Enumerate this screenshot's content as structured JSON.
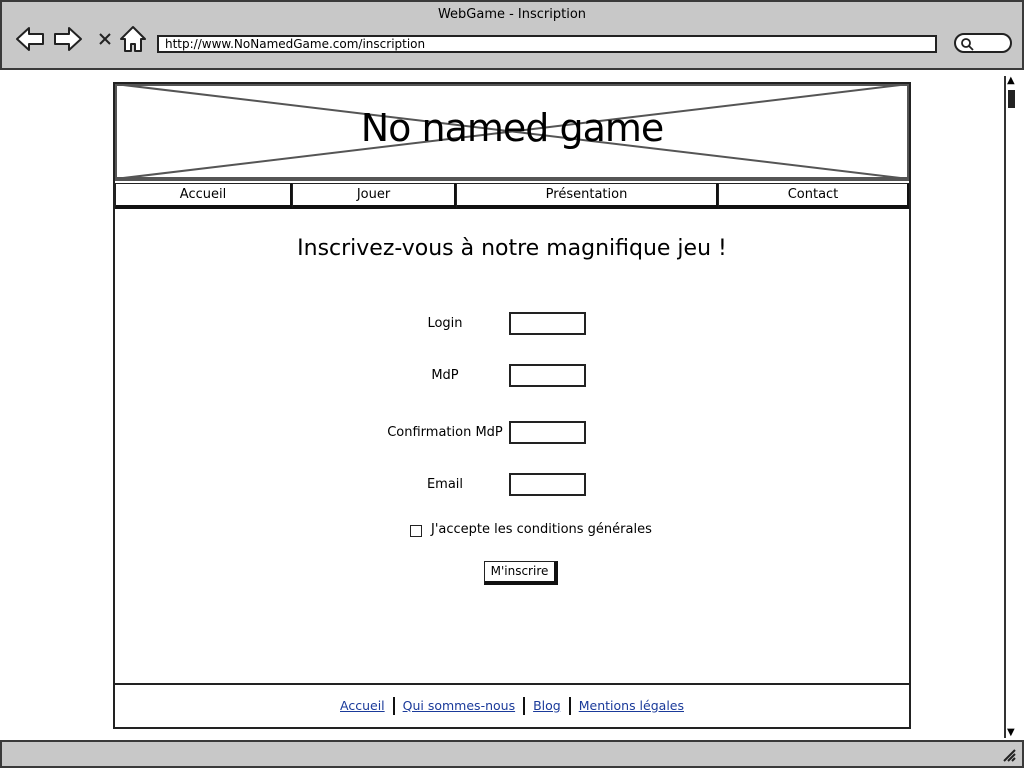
{
  "window": {
    "title": "WebGame - Inscription",
    "url": "http://www.NoNamedGame.com/inscription"
  },
  "banner": {
    "title": "No named game"
  },
  "nav": {
    "tabs": [
      {
        "label": "Accueil"
      },
      {
        "label": "Jouer"
      },
      {
        "label": "Présentation"
      },
      {
        "label": "Contact"
      }
    ]
  },
  "main": {
    "heading": "Inscrivez-vous à notre magnifique jeu !",
    "fields": [
      {
        "label": "Login",
        "value": ""
      },
      {
        "label": "MdP",
        "value": ""
      },
      {
        "label": "Confirmation MdP",
        "value": ""
      },
      {
        "label": "Email",
        "value": ""
      }
    ],
    "terms_label": "J'accepte les conditions générales",
    "terms_checked": false,
    "submit_label": "M'inscrire"
  },
  "footer": {
    "links": [
      {
        "label": "Accueil"
      },
      {
        "label": "Qui sommes-nous"
      },
      {
        "label": "Blog"
      },
      {
        "label": "Mentions légales"
      }
    ]
  },
  "icons": {
    "back": "back-arrow-icon",
    "forward": "forward-arrow-icon",
    "stop": "close-icon",
    "home": "home-icon",
    "search": "search-icon",
    "resize": "resize-grip-icon"
  },
  "colors": {
    "chrome": "#c8c8c8",
    "link": "#1a3a9a"
  }
}
